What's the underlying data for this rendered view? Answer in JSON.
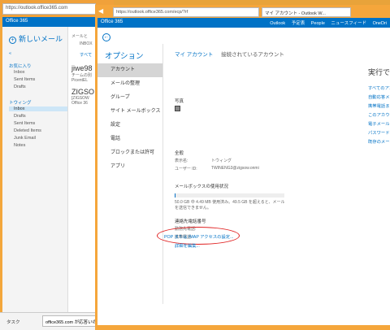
{
  "back_window": {
    "url": "https://outlook.office365.com",
    "suite_title": "Office 365",
    "new_mail_label": "新しいメール",
    "search_placeholder": "メールと",
    "inbox_label": "INBOX",
    "filter_all": "すべて",
    "favorites_header": "お気に入り",
    "favorites": [
      "Inbox",
      "Sent Items",
      "Drafts"
    ],
    "account_header": "トウィング",
    "folders": [
      "Inbox",
      "Drafts",
      "Sent Items",
      "Deleted Items",
      "Junk Email",
      "Notes"
    ],
    "messages": [
      {
        "from": "jiwe98",
        "line1": "チームの別",
        "line2": "PicentEL"
      },
      {
        "from": "ZIGSO",
        "line1": "[ZIGSOW",
        "line2": "Office 36"
      }
    ],
    "taskbar_item": "タスク",
    "notice": "office365.com が応答いの"
  },
  "front_window": {
    "url": "https://outlook.office365.com/ecp/?rf",
    "tab_title": "マイ アカウント - Outlook W...",
    "suite_title": "Office 365",
    "top_nav": [
      "Outlook",
      "予定表",
      "People",
      "ニュースフィード",
      "OneDri"
    ],
    "options_title": "オプション",
    "nav_items": [
      "アカウント",
      "メールの整理",
      "グループ",
      "サイト メールボックス",
      "設定",
      "電話",
      "ブロックまたは許可",
      "アプリ"
    ],
    "content_tabs": [
      "マイ アカウント",
      "接続されているアカウント"
    ],
    "photo_label": "写真",
    "general_header": "全般",
    "display_name_label": "表示名:",
    "display_name_value": "トウィング",
    "user_id_label": "ユーザー ID:",
    "user_id_value": "TWINENG3@zigsow.onmi",
    "mailbox_header": "メールボックスの使用状況",
    "mailbox_usage_text": "50.0 GB 中 4.49 MB 使用済み。49.5 GB を超えると、メールを送信できません。",
    "mailbox_usage_fraction": 0.001,
    "contact_header": "連絡先電話番号",
    "work_phone_label": "勤務先電話:",
    "mobile_phone_label": "携帯電話:",
    "pop_link": "POP または IMAP アクセスの設定...",
    "details_link": "詳細を編集...",
    "right_title": "実行でき",
    "right_links": [
      "すべてのアカウ",
      "自動応答メッセ",
      "携帯電話またはテ",
      "このアカウントに",
      "電子メールを転",
      "パスワードを変更",
      "既存のメールに"
    ]
  },
  "colors": {
    "accent": "#0072c6",
    "frame": "#f0a13a",
    "highlight_oval": "#e02020"
  }
}
